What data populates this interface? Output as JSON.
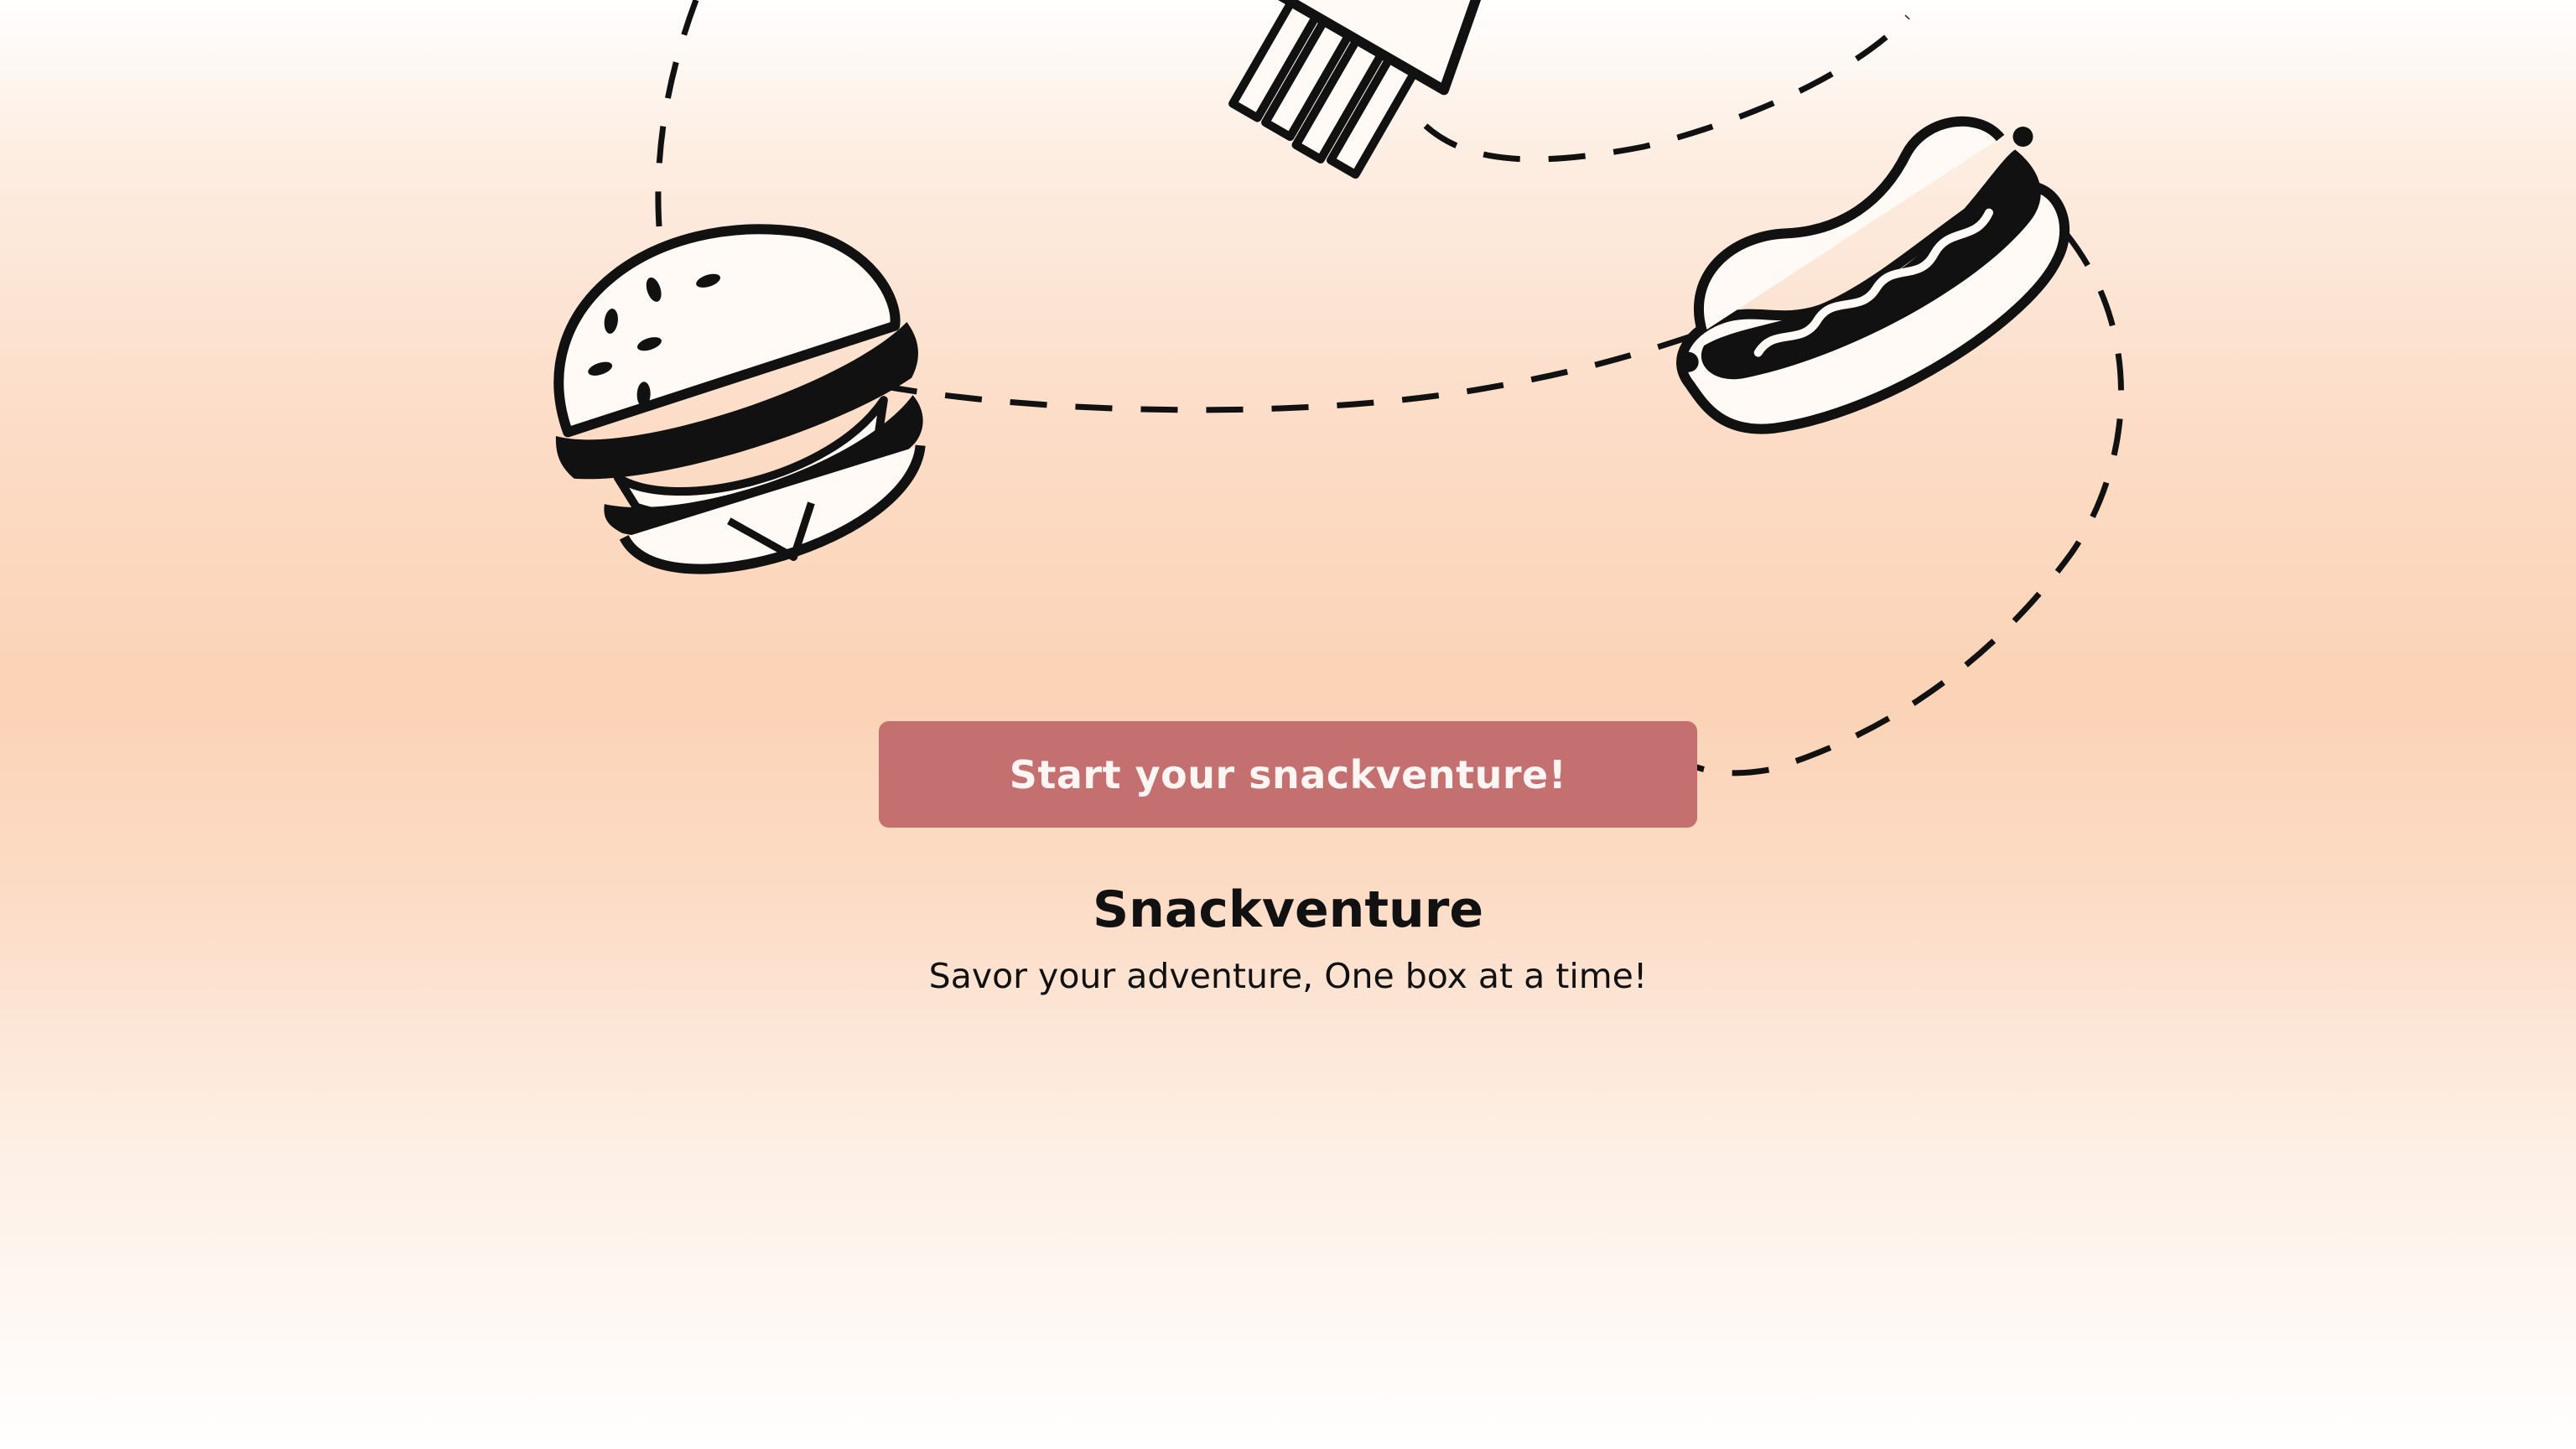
{
  "hero": {
    "cta_label": "Start your snackventure!",
    "brand_name": "Snackventure",
    "tagline": "Savor your adventure, One box at a time!"
  },
  "illustration": {
    "icons": [
      "burger-icon",
      "fries-icon",
      "hotdog-icon"
    ],
    "path_style": "dashed"
  },
  "colors": {
    "cta_background": "#c47070",
    "cta_text": "#fff6f3",
    "gradient_peak": "#fbd3b6",
    "ink": "#111111"
  }
}
